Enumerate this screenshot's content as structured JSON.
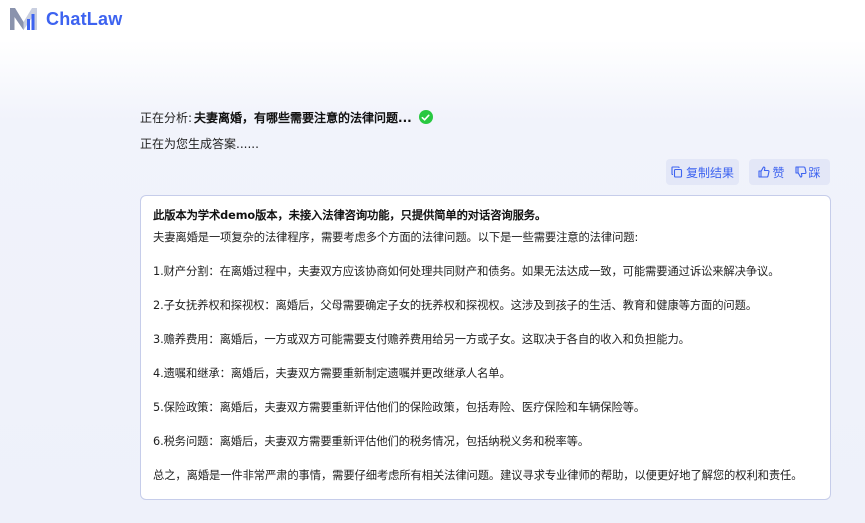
{
  "header": {
    "brand": "ChatLaw",
    "logo_icon": "m-logo-icon",
    "brand_color": "#3d63f0"
  },
  "status": {
    "analysis_prefix": "正在分析:",
    "analysis_topic": "夫妻离婚，有哪些需要注意的法律问题...",
    "check_icon": "check-circle-icon",
    "check_color": "#28c840",
    "generating_text": "正在为您生成答案......"
  },
  "actions": {
    "copy_label": "复制结果",
    "like_label": "赞",
    "dislike_label": "踩"
  },
  "answer": {
    "notice": "此版本为学术demo版本，未接入法律咨询功能，只提供简单的对话咨询服务。",
    "intro": "夫妻离婚是一项复杂的法律程序，需要考虑多个方面的法律问题。以下是一些需要注意的法律问题:",
    "items": [
      "1.财产分割：在离婚过程中，夫妻双方应该协商如何处理共同财产和债务。如果无法达成一致，可能需要通过诉讼来解决争议。",
      "2.子女抚养权和探视权：离婚后，父母需要确定子女的抚养权和探视权。这涉及到孩子的生活、教育和健康等方面的问题。",
      "3.赡养费用：离婚后，一方或双方可能需要支付赡养费用给另一方或子女。这取决于各自的收入和负担能力。",
      "4.遗嘱和继承：离婚后，夫妻双方需要重新制定遗嘱并更改继承人名单。",
      "5.保险政策：离婚后，夫妻双方需要重新评估他们的保险政策，包括寿险、医疗保险和车辆保险等。",
      "6.税务问题：离婚后，夫妻双方需要重新评估他们的税务情况，包括纳税义务和税率等。"
    ],
    "conclusion": "总之，离婚是一件非常严肃的事情，需要仔细考虑所有相关法律问题。建议寻求专业律师的帮助，以便更好地了解您的权利和责任。"
  }
}
